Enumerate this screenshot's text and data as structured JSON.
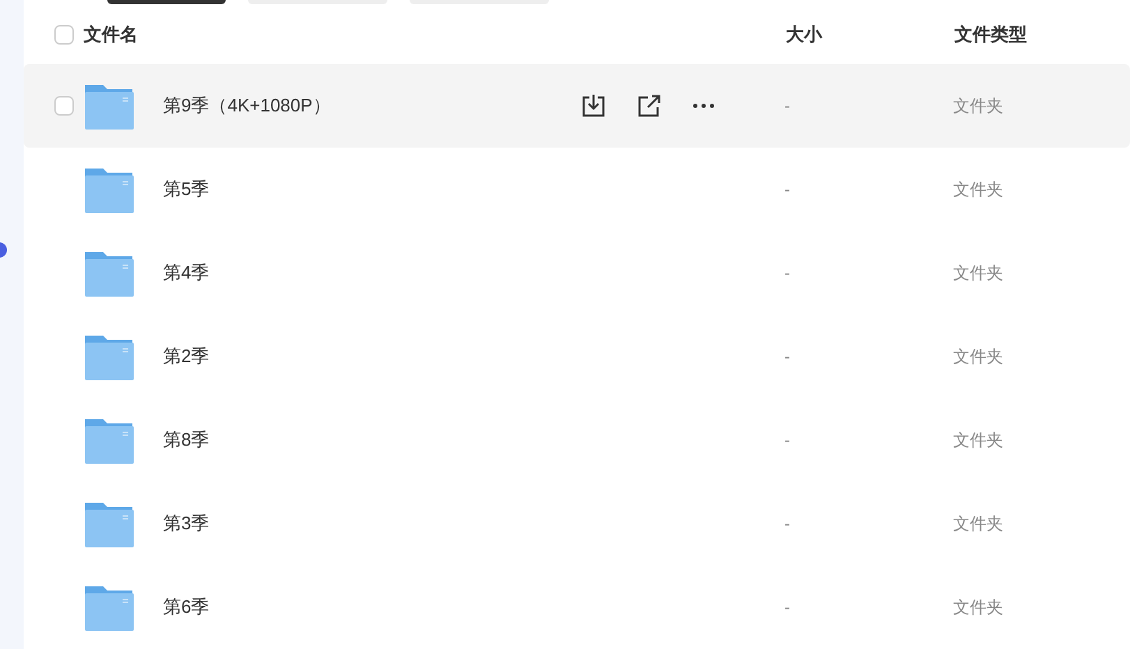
{
  "toolbar_tabs": [
    {
      "selected": true
    },
    {
      "selected": false
    },
    {
      "selected": false
    }
  ],
  "header": {
    "select_all_checked": false,
    "columns": [
      "文件名",
      "大小",
      "文件类型"
    ]
  },
  "rows": [
    {
      "name": "第9季（4K+1080P）",
      "size": "-",
      "type": "文件夹",
      "selected": true
    },
    {
      "name": "第5季",
      "size": "-",
      "type": "文件夹",
      "selected": false
    },
    {
      "name": "第4季",
      "size": "-",
      "type": "文件夹",
      "selected": false
    },
    {
      "name": "第2季",
      "size": "-",
      "type": "文件夹",
      "selected": false
    },
    {
      "name": "第8季",
      "size": "-",
      "type": "文件夹",
      "selected": false
    },
    {
      "name": "第3季",
      "size": "-",
      "type": "文件夹",
      "selected": false
    },
    {
      "name": "第6季",
      "size": "-",
      "type": "文件夹",
      "selected": false
    }
  ]
}
